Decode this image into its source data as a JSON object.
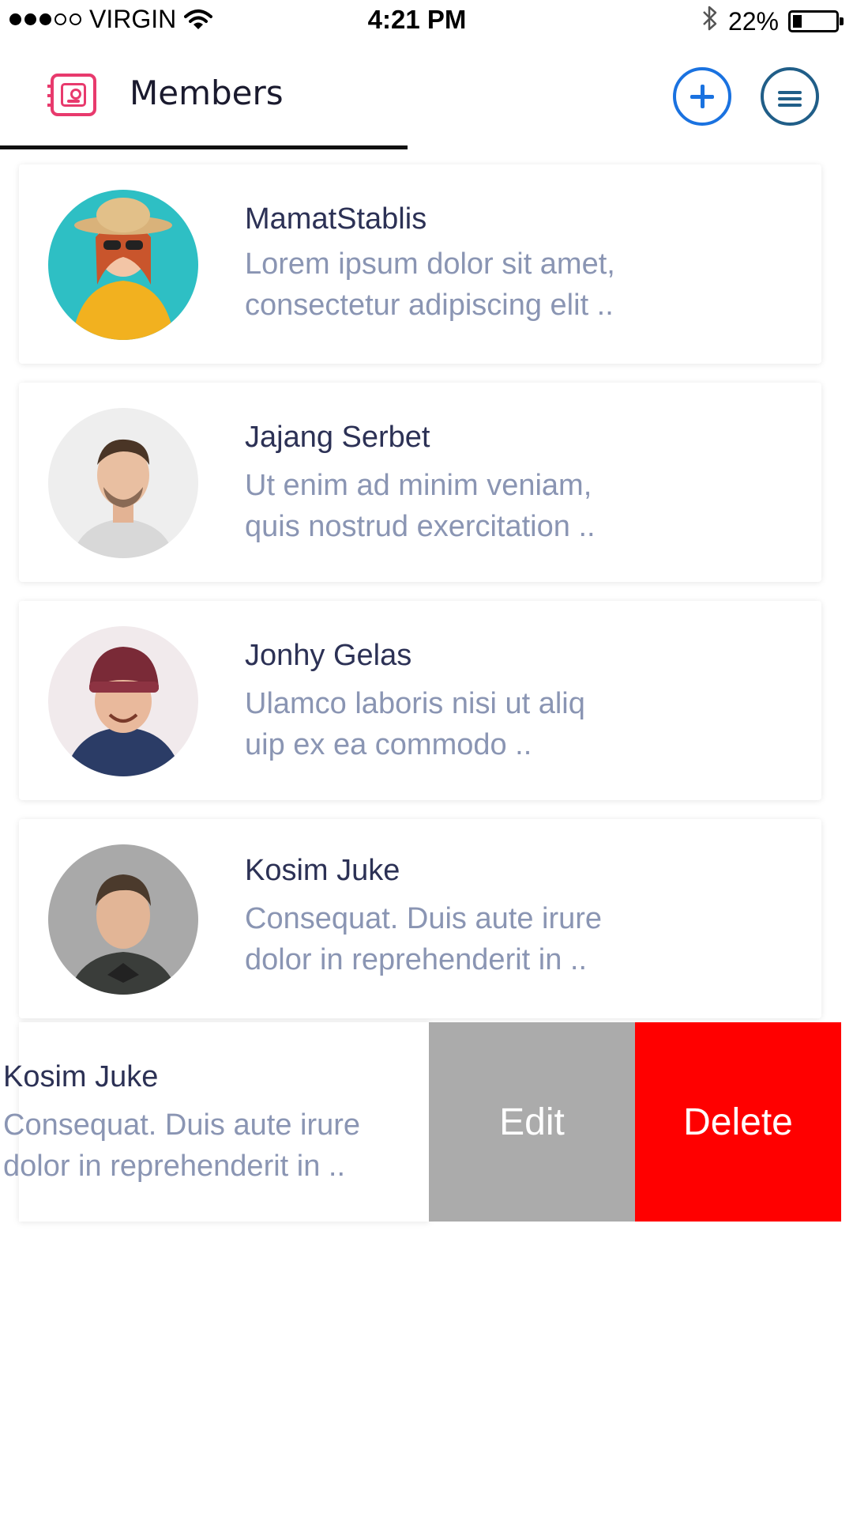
{
  "status_bar": {
    "carrier": "VIRGIN",
    "time": "4:21 PM",
    "battery_percent": "22%",
    "battery_level": 0.22,
    "signal_bars_filled": 3,
    "signal_bars_total": 5,
    "icons": [
      "wifi-icon",
      "bluetooth-icon",
      "battery-icon"
    ]
  },
  "header": {
    "icon": "address-book-icon",
    "title": "Members",
    "add_icon": "plus-circle-icon",
    "menu_icon": "menu-circle-icon",
    "accent_color": "#e83a6d",
    "add_color": "#1a72e0",
    "menu_color": "#205e88"
  },
  "members": [
    {
      "name": "MamatStablis",
      "desc_line1": "Lorem ipsum dolor sit amet,",
      "desc_line2": "consectetur adipiscing elit .."
    },
    {
      "name": "Jajang Serbet",
      "desc_line1": "Ut enim ad minim veniam,",
      "desc_line2": "quis nostrud exercitation .."
    },
    {
      "name": "Jonhy Gelas",
      "desc_line1": "Ulamco laboris nisi ut aliq",
      "desc_line2": "uip ex ea commodo  .."
    },
    {
      "name": "Kosim Juke",
      "desc_line1": "Consequat. Duis aute irure",
      "desc_line2": "dolor in reprehenderit in .."
    }
  ],
  "swiped_row": {
    "name": "Kosim Juke",
    "desc_line1": "Consequat. Duis aute irure",
    "desc_line2": "dolor in reprehenderit in ..",
    "edit_label": "Edit",
    "delete_label": "Delete",
    "edit_color": "#ababab",
    "delete_color": "#ff0000"
  }
}
